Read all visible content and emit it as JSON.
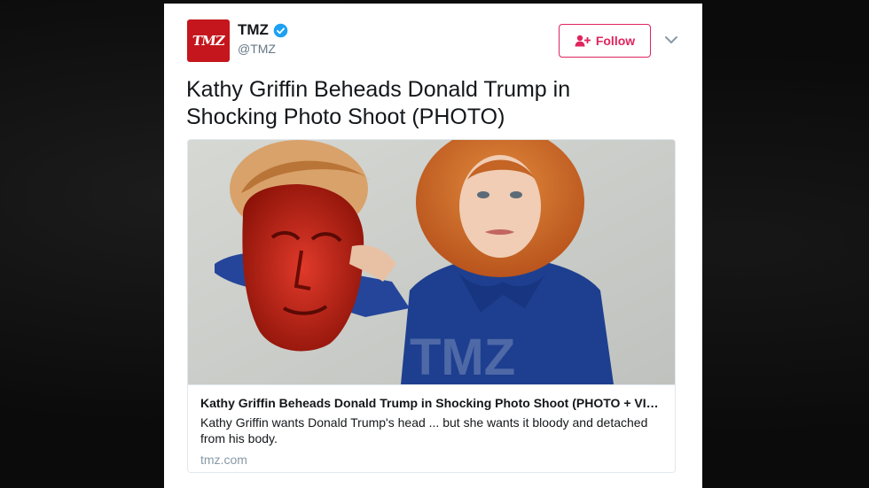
{
  "account": {
    "name": "TMZ",
    "handle": "@TMZ",
    "avatar_text": "TMZ",
    "verified": true
  },
  "follow_button": {
    "label": "Follow",
    "icon": "add-user-icon"
  },
  "menu": {
    "icon": "chevron-down-icon"
  },
  "tweet": {
    "text": "Kathy Griffin Beheads Donald Trump in Shocking Photo Shoot (PHOTO)"
  },
  "link_card": {
    "image_watermark": "TMZ",
    "title": "Kathy Griffin Beheads Donald Trump in Shocking Photo Shoot (PHOTO + VIDE...",
    "description": "Kathy Griffin wants Donald Trump's head ... but she wants it bloody and detached from his body.",
    "domain": "tmz.com"
  },
  "colors": {
    "accent": "#e0245e",
    "verified": "#1da1f2",
    "avatar_bg": "#c4161c",
    "text": "#14171a",
    "muted": "#657786"
  }
}
